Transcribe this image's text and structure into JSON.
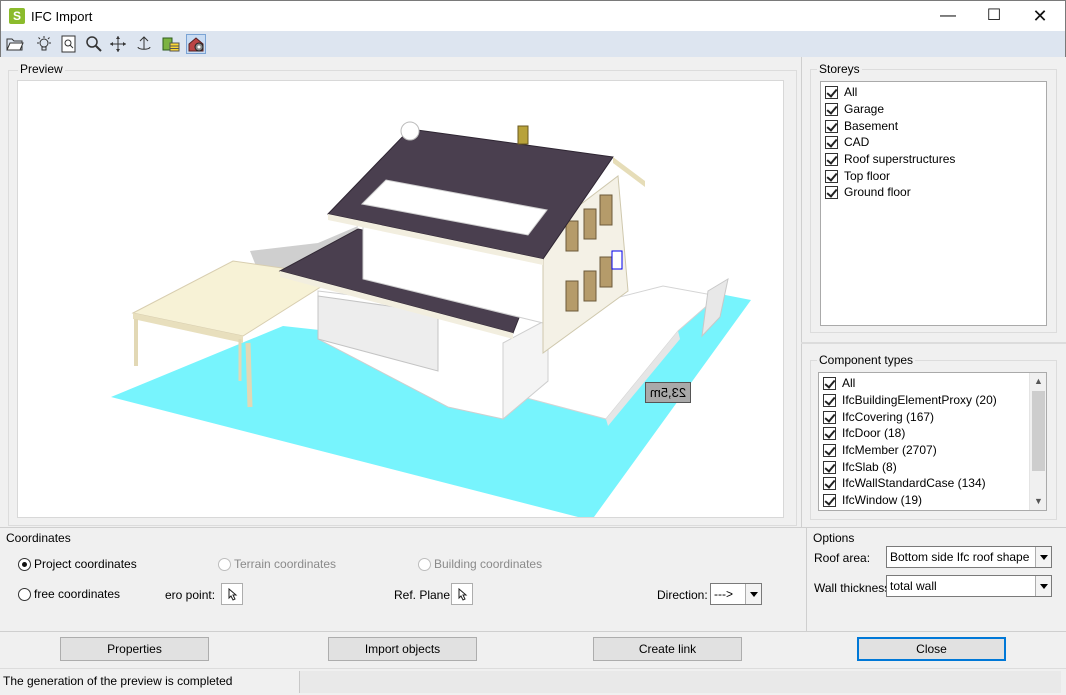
{
  "window": {
    "title": "IFC Import",
    "app_icon": "S",
    "minimize": "—",
    "maximize": "☐",
    "close": "✕"
  },
  "toolbar": {
    "icons": [
      "open-folder-icon",
      "light-bulb-icon",
      "zoom-page-icon",
      "zoom-icon",
      "pan-icon",
      "rotate-icon",
      "layers-icon",
      "render-view-icon"
    ]
  },
  "preview": {
    "label": "Preview",
    "dimension_label": "23,5m",
    "colors": {
      "ground": "#77f4fd",
      "roof": "#4a3f4f",
      "wall": "#ffffff",
      "carport": "#f5f0d0",
      "timber": "#e6ddb8"
    }
  },
  "storeys": {
    "label": "Storeys",
    "items": [
      {
        "label": "All",
        "checked": true
      },
      {
        "label": "Garage",
        "checked": true
      },
      {
        "label": "Basement",
        "checked": true
      },
      {
        "label": "CAD",
        "checked": true
      },
      {
        "label": "Roof superstructures",
        "checked": true
      },
      {
        "label": "Top floor",
        "checked": true
      },
      {
        "label": "Ground floor",
        "checked": true
      }
    ]
  },
  "component_types": {
    "label": "Component types",
    "items": [
      {
        "label": "All",
        "checked": true
      },
      {
        "label": "IfcBuildingElementProxy (20)",
        "checked": true
      },
      {
        "label": "IfcCovering (167)",
        "checked": true
      },
      {
        "label": "IfcDoor (18)",
        "checked": true
      },
      {
        "label": "IfcMember (2707)",
        "checked": true
      },
      {
        "label": "IfcSlab (8)",
        "checked": true
      },
      {
        "label": "IfcWallStandardCase (134)",
        "checked": true
      },
      {
        "label": "IfcWindow (19)",
        "checked": true
      }
    ]
  },
  "coordinates": {
    "label": "Coordinates",
    "project": "Project coordinates",
    "terrain": "Terrain coordinates",
    "building": "Building coordinates",
    "free": "free coordinates",
    "zero_point": "ero point:",
    "ref_plane": "Ref. Plane:",
    "direction": "Direction:",
    "direction_value": "--->",
    "selected": "project"
  },
  "options": {
    "label": "Options",
    "roof_area_label": "Roof area:",
    "roof_area_value": "Bottom side Ifc roof shape",
    "wall_thickness_label": "Wall thickness",
    "wall_thickness_value": "total wall"
  },
  "buttons": {
    "properties": "Properties",
    "import_objects": "Import objects",
    "create_link": "Create link",
    "close": "Close"
  },
  "status": {
    "text": "The generation of the preview is completed"
  },
  "accent": "#0078d7"
}
